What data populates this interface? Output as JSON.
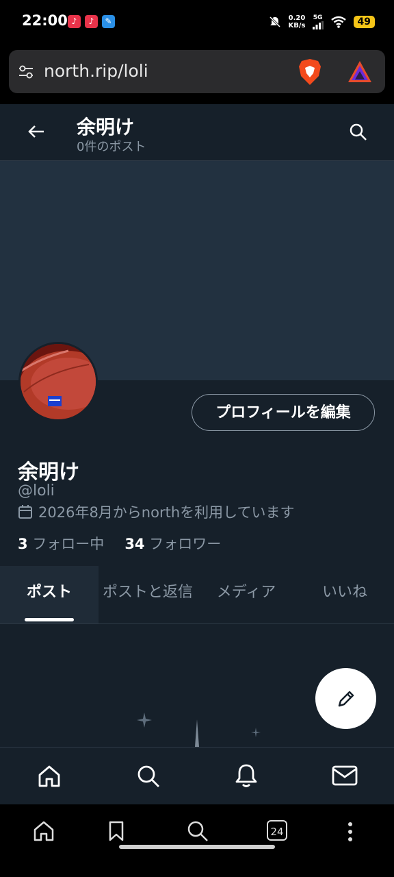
{
  "status_bar": {
    "time": "22:00",
    "net_speed_value": "0.20",
    "net_speed_unit": "KB/s",
    "signal_label": "5G",
    "battery": "49"
  },
  "browser": {
    "url": "north.rip/loli",
    "open_tabs": "24"
  },
  "header": {
    "title": "余明け",
    "subtitle": "0件のポスト"
  },
  "profile": {
    "display_name": "余明け",
    "handle": "@loli",
    "joined": "2026年8月からnorthを利用しています",
    "following_count": "3",
    "following_label": "フォロー中",
    "followers_count": "34",
    "followers_label": "フォロワー",
    "edit_button": "プロフィールを編集"
  },
  "tabs": [
    "ポスト",
    "ポストと返信",
    "メディア",
    "いいね"
  ],
  "app_nav": [
    "home-icon",
    "search-icon",
    "bell-icon",
    "mail-icon"
  ],
  "browser_nav": [
    "home-icon",
    "bookmark-icon",
    "search-icon",
    "tabs-icon",
    "more-icon"
  ],
  "colors": {
    "background": "#16202a",
    "banner": "#223140",
    "secondary_text": "#8b98a5"
  }
}
